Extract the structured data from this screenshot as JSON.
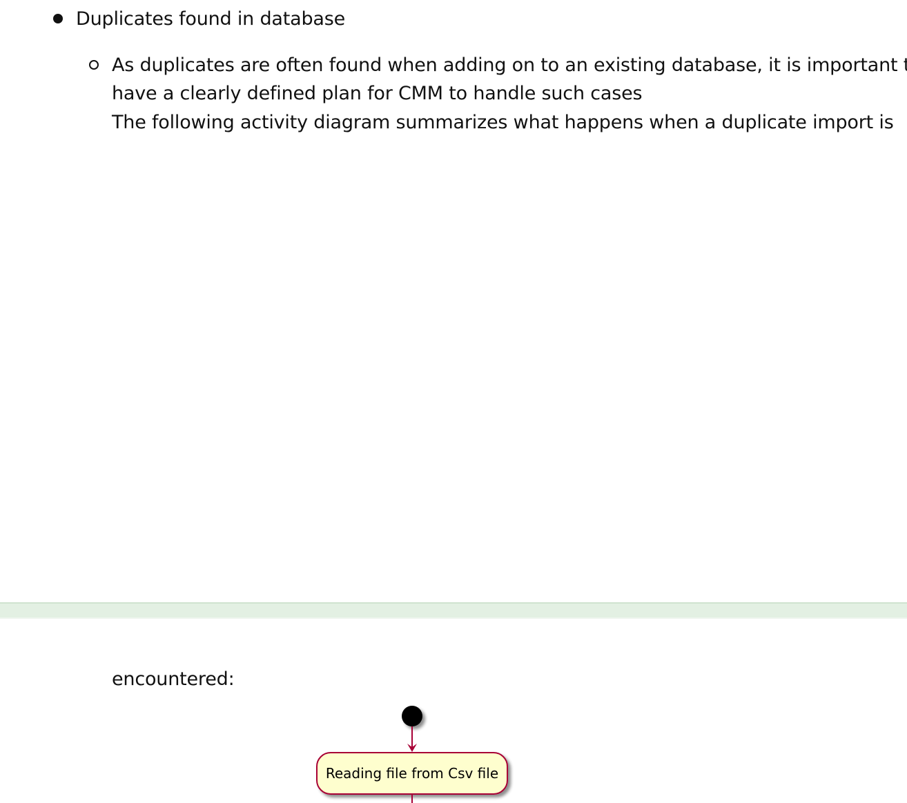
{
  "document": {
    "bullet_item": "Duplicates found in database",
    "sub_item_lines": [
      "As duplicates are often found when adding on to an existing database, it is important to",
      "have a clearly defined plan for CMM to handle such cases",
      "The following activity diagram summarizes what happens when a duplicate import is"
    ],
    "continued_line": "encountered:"
  },
  "diagram": {
    "activities": [
      "Reading file from Csv file"
    ],
    "colors": {
      "start_node": "#000000",
      "activity_fill": "#fefece",
      "activity_border": "#a80036",
      "arrow": "#a80036"
    }
  },
  "colors": {
    "text": "#111111",
    "page_break": "#e3f0e3"
  }
}
